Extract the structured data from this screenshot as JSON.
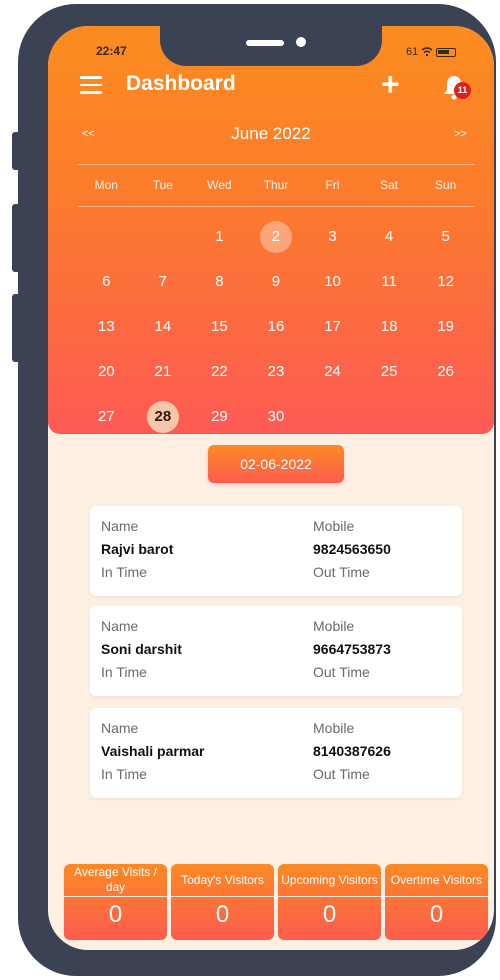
{
  "status": {
    "time": "22:47",
    "battery": "61"
  },
  "header": {
    "title": "Dashboard",
    "add_icon": "plus-icon",
    "notifications_count": "11"
  },
  "calendar": {
    "prev": "<<",
    "next": ">>",
    "month": "June 2022",
    "weekdays": [
      "Mon",
      "Tue",
      "Wed",
      "Thur",
      "Fri",
      "Sat",
      "Sun"
    ],
    "weeks": [
      [
        "",
        "",
        "1",
        "2",
        "3",
        "4",
        "5"
      ],
      [
        "6",
        "7",
        "8",
        "9",
        "10",
        "11",
        "12"
      ],
      [
        "13",
        "14",
        "15",
        "16",
        "17",
        "18",
        "19"
      ],
      [
        "20",
        "21",
        "22",
        "23",
        "24",
        "25",
        "26"
      ],
      [
        "27",
        "28",
        "29",
        "30",
        "",
        "",
        ""
      ]
    ],
    "selected_day": "2",
    "today_day": "28"
  },
  "selected_date": "02-06-2022",
  "visitors": [
    {
      "name_label": "Name",
      "name": "Rajvi barot",
      "mobile_label": "Mobile",
      "mobile": "9824563650",
      "in_label": "In Time",
      "out_label": "Out Time"
    },
    {
      "name_label": "Name",
      "name": "Soni darshit",
      "mobile_label": "Mobile",
      "mobile": "9664753873",
      "in_label": "In Time",
      "out_label": "Out Time"
    },
    {
      "name_label": "Name",
      "name": "Vaishali parmar",
      "mobile_label": "Mobile",
      "mobile": "8140387626",
      "in_label": "In Time",
      "out_label": "Out Time"
    }
  ],
  "stats": [
    {
      "label": "Average Visits / day",
      "value": "0"
    },
    {
      "label": "Today's Visitors",
      "value": "0"
    },
    {
      "label": "Upcoming Visitors",
      "value": "0"
    },
    {
      "label": "Overtime Visitors",
      "value": "0"
    }
  ],
  "colors": {
    "orange": "#fb8c1f",
    "red": "#fd5a55",
    "bg": "#fdf0e3",
    "frame": "#3b4254"
  }
}
